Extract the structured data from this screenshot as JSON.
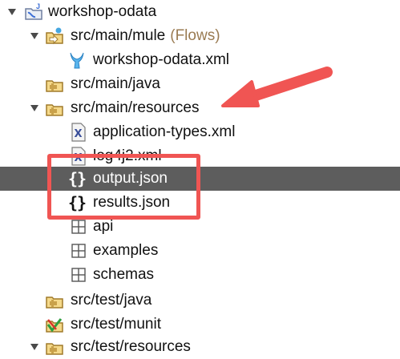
{
  "tree": {
    "items": [
      {
        "label": "workshop-odata",
        "decoration": "",
        "icon": "project-icon",
        "expanded": true
      },
      {
        "label": "src/main/mule",
        "decoration": "(Flows)",
        "icon": "mule-folder-icon",
        "expanded": true
      },
      {
        "label": "workshop-odata.xml",
        "decoration": "",
        "icon": "mule-flow-file-icon"
      },
      {
        "label": "src/main/java",
        "decoration": "",
        "icon": "source-folder-icon"
      },
      {
        "label": "src/main/resources",
        "decoration": "",
        "icon": "source-folder-icon",
        "expanded": true
      },
      {
        "label": "application-types.xml",
        "decoration": "",
        "icon": "xml-file-icon"
      },
      {
        "label": "log4j2.xml",
        "decoration": "",
        "icon": "xml-file-icon"
      },
      {
        "label": "output.json",
        "decoration": "",
        "icon": "json-file-icon",
        "selected": true
      },
      {
        "label": "results.json",
        "decoration": "",
        "icon": "json-file-icon"
      },
      {
        "label": "api",
        "decoration": "",
        "icon": "package-icon"
      },
      {
        "label": "examples",
        "decoration": "",
        "icon": "package-icon"
      },
      {
        "label": "schemas",
        "decoration": "",
        "icon": "package-icon"
      },
      {
        "label": "src/test/java",
        "decoration": "",
        "icon": "source-folder-icon"
      },
      {
        "label": "src/test/munit",
        "decoration": "",
        "icon": "munit-folder-icon"
      },
      {
        "label": "src/test/resources",
        "decoration": "",
        "icon": "source-folder-icon",
        "expanded": true
      }
    ]
  },
  "annotation": {
    "arrow_color": "#f05553",
    "box_color": "#f05553"
  },
  "colors": {
    "selection": "#5d5d5d",
    "decoration": "#9a7b52"
  }
}
